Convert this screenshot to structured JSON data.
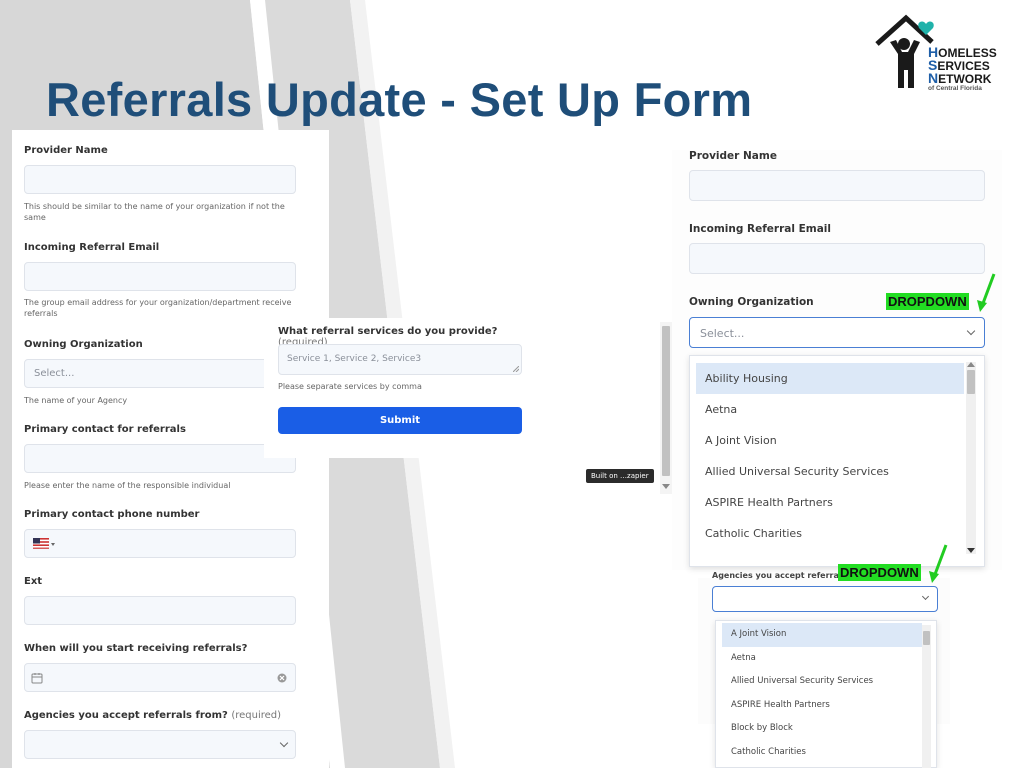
{
  "slide": {
    "title": "Referrals Update - Set Up Form"
  },
  "logo": {
    "line1_cap": "H",
    "line1": "OMELESS",
    "line2_cap": "S",
    "line2": "ERVICES",
    "line3_cap": "N",
    "line3": "ETWORK",
    "line4": "of Central Florida",
    "icon": "house-person-heart-icon"
  },
  "form_left": {
    "provider_name_label": "Provider Name",
    "provider_name_hint": "This should be similar to the name of your organization if not the same",
    "email_label": "Incoming Referral Email",
    "email_hint": "The group email address for your organization/department receive referrals",
    "owning_org_label": "Owning Organization",
    "owning_org_placeholder": "Select...",
    "owning_org_hint": "The name of your Agency",
    "primary_contact_label": "Primary contact for referrals",
    "primary_contact_hint": "Please enter the name of the responsible individual",
    "phone_label": "Primary contact phone number",
    "ext_label": "Ext",
    "start_label": "When will you start receiving referrals?",
    "agencies_label": "Agencies you accept referrals from?",
    "agencies_required": "(required)"
  },
  "form_middle": {
    "services_label": "What referral services do you provide?",
    "services_required": "(required)",
    "services_placeholder": "Service 1,  Service 2, Service3",
    "services_hint": "Please separate services by comma",
    "submit_label": "Submit",
    "badge": "Built on …zapier"
  },
  "form_right": {
    "provider_name_label": "Provider Name",
    "email_label": "Incoming Referral Email",
    "owning_org_label": "Owning Organization",
    "owning_org_placeholder": "Select...",
    "tag1": "DROPDOWN",
    "tag2": "DROPDOWN",
    "agencies_label_partial": "Agencies you accept referrals fro",
    "dropdown1_options": [
      "Ability Housing",
      "Aetna",
      "A Joint Vision",
      "Allied Universal Security Services",
      "ASPIRE Health Partners",
      "Catholic Charities"
    ],
    "dropdown2_options": [
      "A Joint Vision",
      "Aetna",
      "Allied Universal Security Services",
      "ASPIRE Health Partners",
      "Block by Block",
      "Catholic Charities"
    ]
  },
  "colors": {
    "title": "#1f4e79",
    "submit": "#1a5ee6",
    "tag": "#22dd22",
    "highlight": "#dce8f7"
  }
}
